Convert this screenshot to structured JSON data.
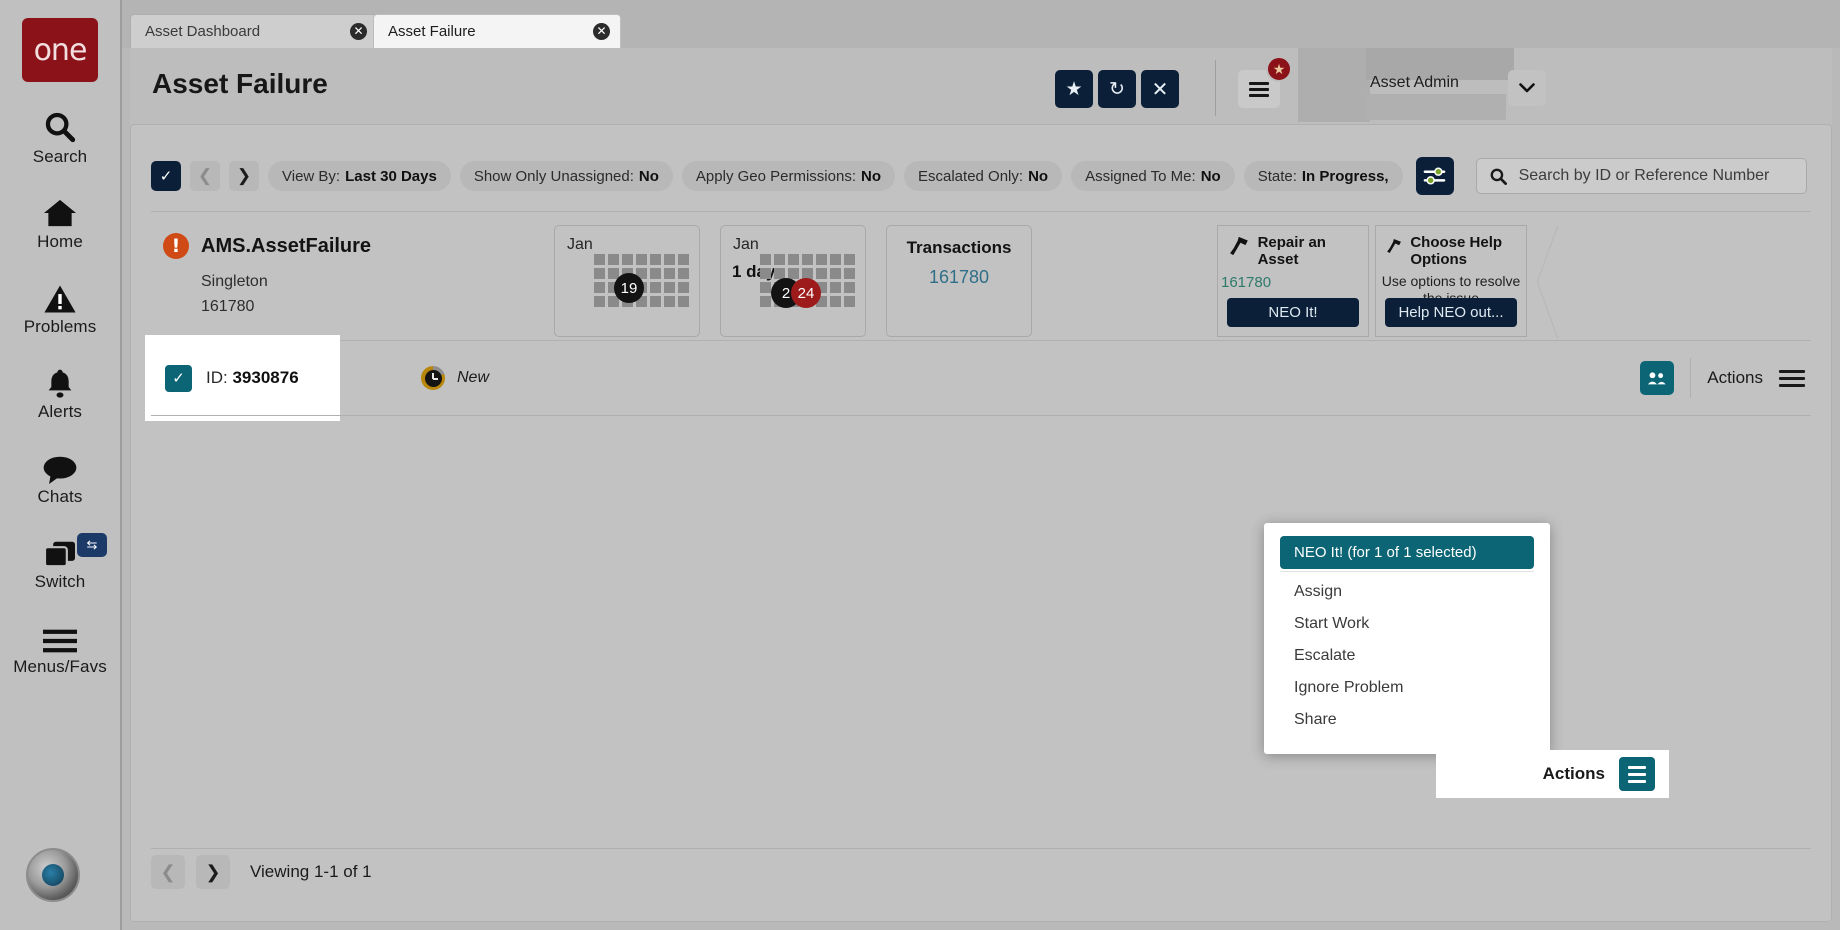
{
  "brand": {
    "logo_text": "one"
  },
  "sidebar": {
    "items": [
      {
        "label": "Search",
        "icon": "search-icon"
      },
      {
        "label": "Home",
        "icon": "home-icon"
      },
      {
        "label": "Problems",
        "icon": "warning-triangle-icon"
      },
      {
        "label": "Alerts",
        "icon": "bell-icon"
      },
      {
        "label": "Chats",
        "icon": "chat-bubble-icon"
      },
      {
        "label": "Switch",
        "icon": "switch-windows-icon",
        "badge_icon": "swap-arrows-icon"
      },
      {
        "label": "Menus/Favs",
        "icon": "hamburger-icon"
      }
    ]
  },
  "tabs": [
    {
      "label": "Asset Dashboard",
      "active": false,
      "close_icon": "close-circle-icon"
    },
    {
      "label": "Asset Failure",
      "active": true,
      "close_icon": "close-circle-icon"
    }
  ],
  "header": {
    "title": "Asset Failure",
    "buttons": [
      {
        "name": "favorite-button",
        "icon": "star-icon",
        "glyph": "★"
      },
      {
        "name": "refresh-button",
        "icon": "refresh-icon",
        "glyph": "↻"
      },
      {
        "name": "close-button",
        "icon": "close-x-icon",
        "glyph": "✕"
      }
    ],
    "menu_icon": "hamburger-icon",
    "menu_badge_icon": "star-icon",
    "menu_badge_glyph": "★",
    "role": "Asset Admin",
    "role_caret_icon": "chevron-down-icon",
    "role_caret_glyph": "❯"
  },
  "filters": {
    "select_all_icon": "checkmark-icon",
    "prev_icon": "chevron-left-icon",
    "next_icon": "chevron-right-icon",
    "chips": [
      {
        "label": "View By:",
        "value": "Last 30 Days"
      },
      {
        "label": "Show Only Unassigned:",
        "value": "No"
      },
      {
        "label": "Apply Geo Permissions:",
        "value": "No"
      },
      {
        "label": "Escalated Only:",
        "value": "No"
      },
      {
        "label": "Assigned To Me:",
        "value": "No"
      },
      {
        "label": "State:",
        "value": "In Progress,"
      }
    ],
    "settings_icon": "sliders-icon"
  },
  "search": {
    "icon": "search-icon",
    "placeholder": "Search by ID or Reference Number"
  },
  "summary": {
    "alert_icon": "alert-exclamation-icon",
    "title": "AMS.AssetFailure",
    "subtitle_line1": "Singleton",
    "subtitle_line2": "161780",
    "calendar_cards": [
      {
        "month": "Jan",
        "duration": "",
        "pips": [
          {
            "value": "19",
            "color": "black"
          }
        ]
      },
      {
        "month": "Jan",
        "duration": "1 day",
        "pips": [
          {
            "value": "2",
            "color": "black"
          },
          {
            "value": "24",
            "color": "red"
          }
        ]
      }
    ],
    "transactions": {
      "label": "Transactions",
      "value": "161780"
    },
    "action_cards": [
      {
        "icon": "hammer-icon",
        "title": "Repair an Asset",
        "number": "161780",
        "description": "",
        "button": "NEO It!"
      },
      {
        "icon": "hammer-icon",
        "title": "Choose Help Options",
        "number": "",
        "description": "Use options to resolve the issue",
        "button": "Help NEO out..."
      }
    ]
  },
  "row": {
    "checkbox_icon": "checkmark-icon",
    "id_label": "ID:",
    "id_value": "3930876",
    "state_icon": "clock-icon",
    "state": "New",
    "people_icon": "people-icon",
    "people_glyph": "⛬",
    "actions_label": "Actions",
    "actions_icon": "hamburger-icon"
  },
  "dropdown": {
    "primary": "NEO It! (for 1 of 1 selected)",
    "items": [
      "Assign",
      "Start Work",
      "Escalate",
      "Ignore Problem",
      "Share"
    ]
  },
  "floating_actions": {
    "label": "Actions",
    "icon": "hamburger-icon"
  },
  "footer": {
    "prev_icon": "chevron-left-icon",
    "next_icon": "chevron-right-icon",
    "text": "Viewing 1-1 of 1"
  },
  "colors": {
    "brand_red": "#8b1218",
    "navy": "#0b2038",
    "teal": "#0b6575",
    "alert_orange": "#cf4a14",
    "link_blue": "#2f6f88",
    "red_pip": "#9e1b1b"
  }
}
